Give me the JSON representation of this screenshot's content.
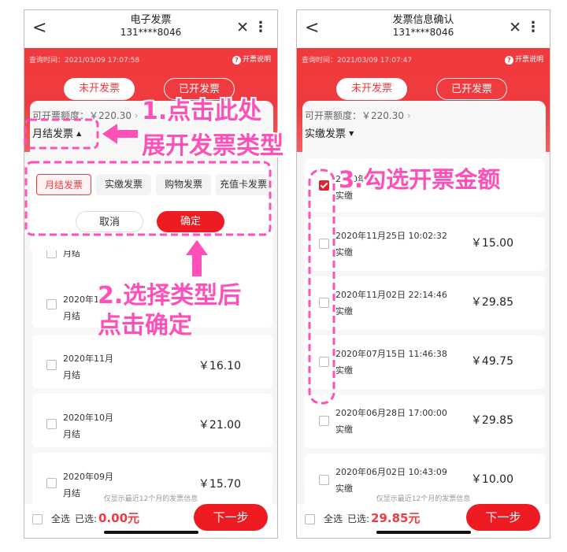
{
  "left": {
    "nav": {
      "back": "<",
      "title": "电子发票",
      "phone": "131****8046",
      "close": "✕",
      "more": "⋮"
    },
    "query_time": "查询时间：2021/03/09 17:07:58",
    "help": "开票说明",
    "tabs": {
      "active": "未开发票",
      "inactive": "已开发票"
    },
    "quota": "可开票额度：￥220.30",
    "filter": "月结发票",
    "sheet": {
      "chips": [
        "月结发票",
        "实缴发票",
        "购物发票",
        "充值卡发票"
      ],
      "cancel": "取消",
      "confirm": "确定"
    },
    "cards": [
      {
        "date": "",
        "type": "月结",
        "amount": ""
      },
      {
        "date": "2020年12月",
        "type": "月结",
        "amount": ""
      },
      {
        "date": "2020年11月",
        "type": "月结",
        "amount": "￥16.10"
      },
      {
        "date": "2020年10月",
        "type": "月结",
        "amount": "￥21.00"
      },
      {
        "date": "2020年09月",
        "type": "月结",
        "amount": "￥15.70"
      }
    ],
    "notice": "仅显示最近12个月的发票信息",
    "footer": {
      "all": "全选",
      "selected_label": "已选:",
      "selected_value": "0.00元",
      "next": "下一步"
    }
  },
  "right": {
    "nav": {
      "back": "<",
      "title": "发票信息确认",
      "phone": "131****8046",
      "close": "✕",
      "more": "⋮"
    },
    "query_time": "查询时间：2021/03/09 17:07:47",
    "help": "开票说明",
    "tabs": {
      "active": "未开发票",
      "inactive": "已开发票"
    },
    "quota": "可开票额度：￥220.30",
    "filter": "实缴发票",
    "cards": [
      {
        "date": "2020年1",
        "type": "实缴",
        "amount": "",
        "checked": true
      },
      {
        "date": "2020年11月25日 10:02:32",
        "type": "实缴",
        "amount": "￥15.00",
        "checked": false
      },
      {
        "date": "2020年11月02日 22:14:46",
        "type": "实缴",
        "amount": "￥29.85",
        "checked": false
      },
      {
        "date": "2020年07月15日 11:46:38",
        "type": "实缴",
        "amount": "￥49.75",
        "checked": false
      },
      {
        "date": "2020年06月28日 17:00:00",
        "type": "实缴",
        "amount": "￥29.85",
        "checked": false
      },
      {
        "date": "2020年06月02日 10:43:09",
        "type": "实缴",
        "amount": "￥10.00",
        "checked": false
      }
    ],
    "notice": "仅显示最近12个月的发票信息",
    "footer": {
      "all": "全选",
      "selected_label": "已选:",
      "selected_value": "29.85元",
      "next": "下一步"
    }
  },
  "annotations": {
    "step1_line1": "1.点击此处",
    "step1_line2": "展开发票类型",
    "step2_line1": "2.选择类型后",
    "step2_line2": "点击确定",
    "step3": "3.勾选开票金额"
  },
  "colors": {
    "brand_red": "#ef3b3f",
    "annotation_pink": "#ff4fb8"
  }
}
